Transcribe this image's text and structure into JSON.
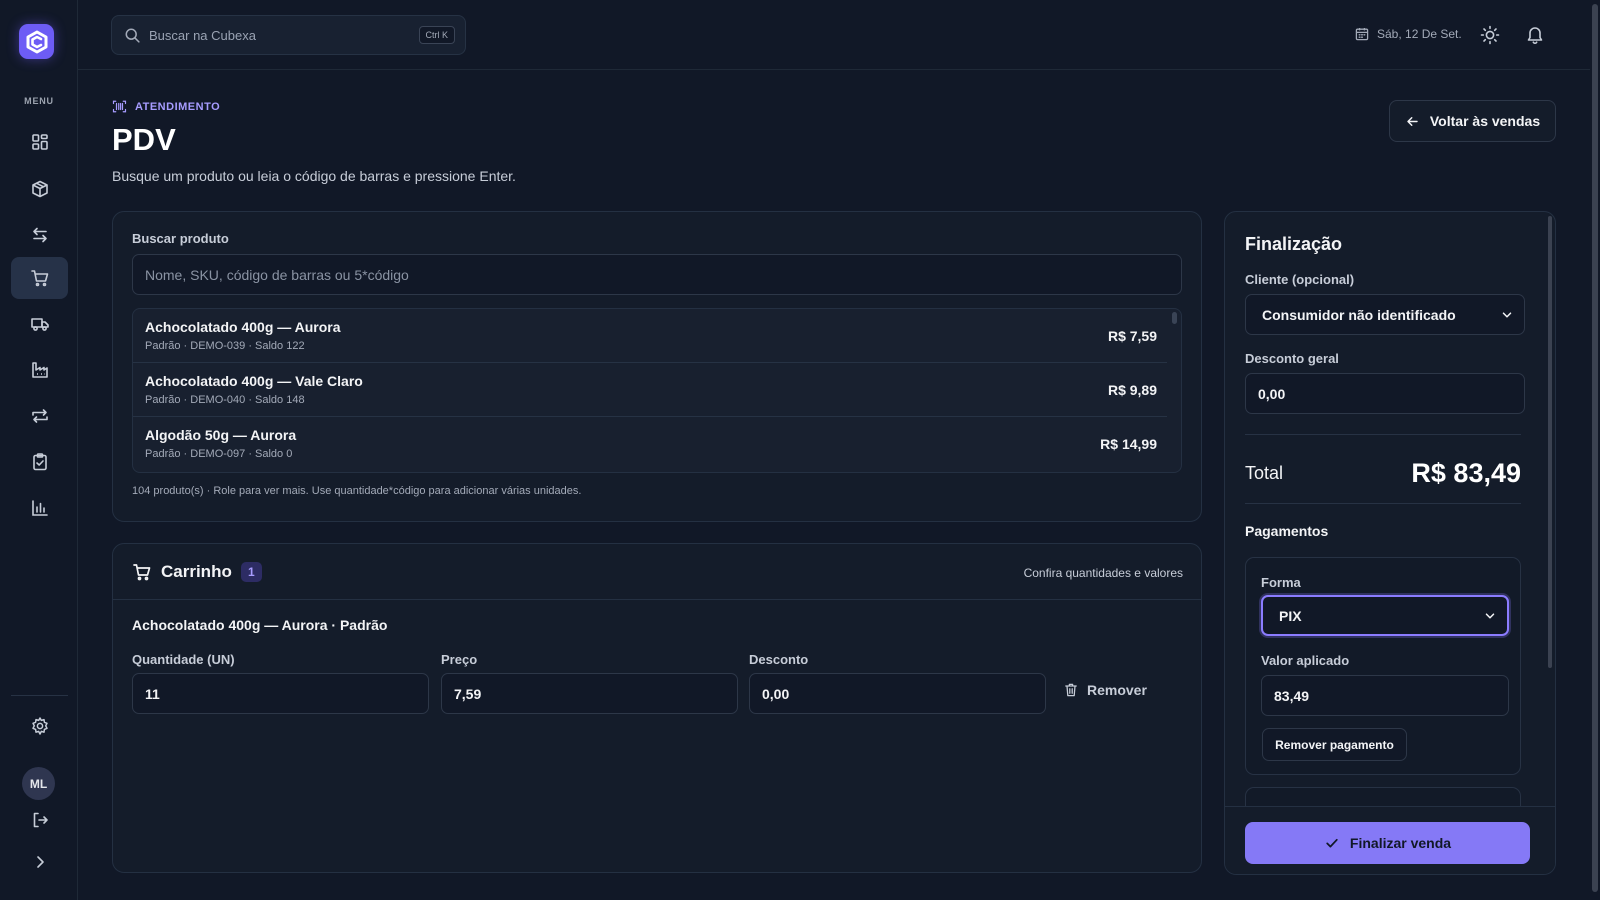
{
  "app": {
    "logo_icon": "cubexa-logo-icon",
    "accent": "#8579f6",
    "accent_light": "#a79cff"
  },
  "sidebar": {
    "menu_label": "MENU",
    "items": [
      {
        "icon": "dashboard-icon",
        "active": false
      },
      {
        "icon": "box-icon",
        "active": false
      },
      {
        "icon": "transfer-arrows-icon",
        "active": false
      },
      {
        "icon": "cart-icon",
        "active": true
      },
      {
        "icon": "truck-icon",
        "active": false
      },
      {
        "icon": "factory-icon",
        "active": false
      },
      {
        "icon": "repeat-icon",
        "active": false
      },
      {
        "icon": "clipboard-check-icon",
        "active": false
      },
      {
        "icon": "bar-chart-icon",
        "active": false
      }
    ],
    "avatar_initials": "ML"
  },
  "topbar": {
    "search_placeholder": "Buscar na Cubexa",
    "shortcut": "Ctrl K",
    "date": "Sáb, 12 De Set."
  },
  "page": {
    "eyebrow": "ATENDIMENTO",
    "title": "PDV",
    "subtitle": "Busque um produto ou leia o código de barras e pressione Enter.",
    "back_button": "Voltar às vendas"
  },
  "search_card": {
    "label": "Buscar produto",
    "placeholder": "Nome, SKU, código de barras ou 5*código",
    "products": [
      {
        "name": "Achocolatado 400g — Aurora",
        "meta": "Padrão · DEMO-039 · Saldo 122",
        "price": "R$ 7,59"
      },
      {
        "name": "Achocolatado 400g — Vale Claro",
        "meta": "Padrão · DEMO-040 · Saldo 148",
        "price": "R$ 9,89"
      },
      {
        "name": "Algodão 50g — Aurora",
        "meta": "Padrão · DEMO-097 · Saldo 0",
        "price": "R$ 14,99"
      }
    ],
    "hint": "104 produto(s) · Role para ver mais. Use quantidade*código para adicionar várias unidades."
  },
  "cart": {
    "title": "Carrinho",
    "count": "1",
    "hint": "Confira quantidades e valores",
    "item": {
      "name": "Achocolatado 400g — Aurora · Padrão",
      "quantity_label": "Quantidade (UN)",
      "quantity": "11",
      "price_label": "Preço",
      "price": "7,59",
      "discount_label": "Desconto",
      "discount": "0,00",
      "remove_label": "Remover"
    }
  },
  "finalizacao": {
    "title": "Finalização",
    "client_label": "Cliente (opcional)",
    "client_value": "Consumidor não identificado",
    "discount_label": "Desconto geral",
    "discount_value": "0,00",
    "total_label": "Total",
    "total_value": "R$ 83,49",
    "payments_title": "Pagamentos",
    "payment": {
      "method_label": "Forma",
      "method_value": "PIX",
      "amount_label": "Valor aplicado",
      "amount_value": "83,49",
      "remove_label": "Remover pagamento"
    },
    "finalize_label": "Finalizar venda"
  }
}
